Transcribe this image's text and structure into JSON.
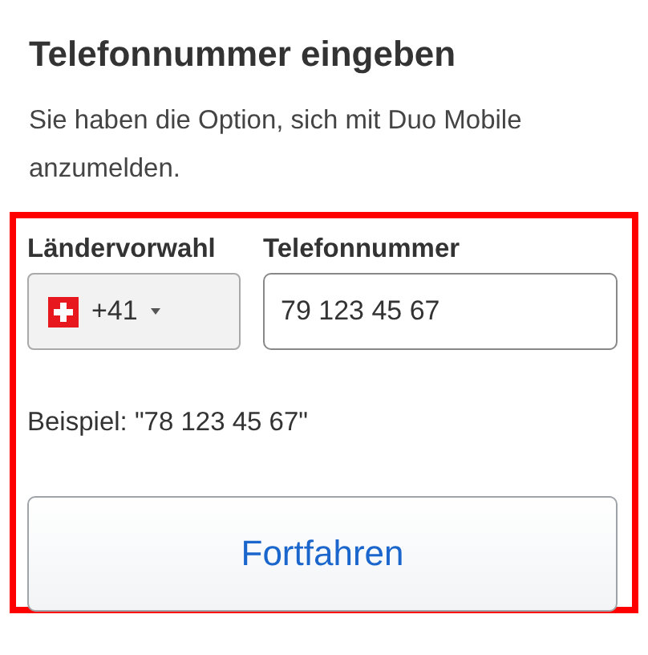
{
  "title": "Telefonnummer eingeben",
  "description": "Sie haben die Option, sich mit Duo Mobile anzumelden.",
  "country_code": {
    "label": "Ländervorwahl",
    "value": "+41"
  },
  "phone": {
    "label": "Telefonnummer",
    "value": "79 123 45 67"
  },
  "example": "Beispiel: \"78 123 45 67\"",
  "button": "Fortfahren"
}
